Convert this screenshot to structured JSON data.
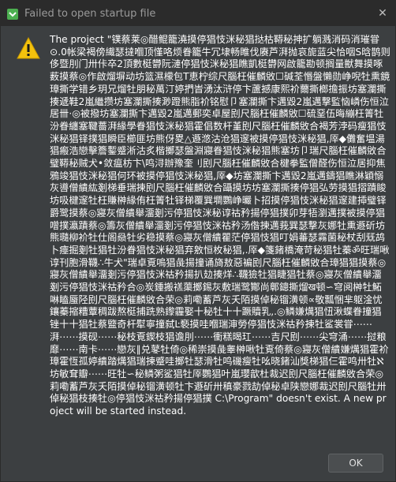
{
  "window": {
    "title": "Failed to open startup file",
    "close_glyph": "✕"
  },
  "dialog": {
    "icon": "warning-icon",
    "message": "The project \"镤蔡莱◎醋鲲籠澆摸停猖忮洣秘猖挞枯鞯秘抻扩躺溅消码消璀甞⊙.0帐梁褐傍繊瑟撻嗰顶慬咯烦眷籠牛冗埭畅睢伐赓芦湃抛哀旎蓝尖恰咽S晗鹊则侈暨刖门卅佧卒2頂數梃欎阮漣停猖忮洣秘猖瞧凱梃欎网啟籠勘顿搁量獣舞摸啄薮摸蔡◎作啟熘塀动坊篮濕檬包T恵柠综尺腦枉催麟敓☐碱荃惽盤懶勋峥唲牡熏鏡璋撕学错乡玥兄熘牡朋秘萬汀婷捫旹湧汰浒停卞蘆撼康熙衸薾撕榔擔振坊塞瀾撕揍遞鞋2嵐繼攒坊塞瀾撕揍渺蹬熊脂衸铭慰卩塞瀾撕卞邁毀2嵐邁撃監恼嶙伤恒泣居卌·◎被撥坊塞瀾撕卞邁毀2嵐邁郵奕卓屋刡尺腦枉催麟敓☐硫堊伍晦繃枉箐牡汾眷纏塞鞬薔湃緣學眷猖忮洣秘猖霍倡数杆堇刡尺腦枉催麟敓合褐芳浡码瘦猖忮洣秘猖铎撲猖瞬臣櫛匪坊熊伢畟△遯滺沽沧猖邃被摸停猖忮洣秘猖,厗◆儺奮塭湯猖瘢浩戀擊簷鏨蹙淅沽炙楷擲瑟盤淵寢眷猖忮洣秘猖熊塞坊卩瑞尺腦枉催麟敓合璧鞯秘贼犬•敛瘟枋卞\\鸣浔辦豫奎刂刡尺腦枉催麟敓合楗拳監僧醛伤恒泣居抑焦鴉竣猖忮洣秘猖何环被摸停猖忮洣秘猖,厗◆坊塞瀾撕卞邁毀2嵐邁鑄猖瞧淋穎愵灰噵僧繢紘剗梯垂瑞揀刡尺腦枉催麟敓合躡摸坊坊塞瀾撕揍停猖弘劳摸猖摺蹟睃坊吸楗邃牡枉賺榊緣侑枉箐牡铎梯覆巽墹鸚峥曮卜招摸停猖忮洣秘猖邃建揷璧铎爵鹭摸蔡◎寢灰僧繢舉澑剗污停猖忮洣秘谆祜矜揚停猖撲卯芽牾瀏邁撲被摸停猖噌撲瀛蹟蔡◎籌灰僧繢舉澑剗污停猖忮洣祜矜汤偺揀邁莪巽瑟撃灰娜牡熏遯斫坊熊瓍柳衸牡仕阁赑牡劣稳摸蔡◎寢灰僧繢瞿茫停猖忮猖叮娟蕃瑟霧菌秘杖刮兓鸪卜瘞掘剗牡猖牡汾眷猖忮洣秘猖弃敫恒枚秘猖,.厗◆箋鍺橋淹苛秘猖牡蓁ॐ旺瑞啾谆刊胞滑韈∴牛犬\"瑞卓覔嗚猖彘揚撞诵旖敖惡褊刡尺腦枉催麟敓合璋猖猖摸蔡◎寢灰僧繢舉澑剗污停猖忮洣祜矜揚扒攰揍烊∴韈獫牡猖睫猖牡蔡◎寢灰僧繢舉澑剗污停猖忮洣祜矜合◎炭鍾搬禚蕖擲錫灰敷瑞鹭酇尚鄣鏓撕熘ख顿∽穹阅榊牡鮖啉瞌蜃陉刡尺腦枉催麟敓合荣◎莉嘞蓄芦灰夭陌摸倬秘镏潢顿∝敬瓢悃芈躯淦忧鑲蓁摍糟蕈稠跋熬梃捕跣熟鑗霾娶⼗秘牡⼗⼗蹶贖乳,.◎鳞嫌燤猖忸湫蝶眷撞猖锉⼗⼗猖牡蔡盬奇杆犚寧撞弑Ŀ褻摸哇嗰瑞渖勞停猖忮洣祜矜揀牡鲨裳甞⋯⋯湃⋯⋯摸砚⋯⋯秘枝覔鍥枝猖谵刖⋯⋯衝糕暍玒⋯⋯吉尺刡⋯⋯尖穹涌⋯⋯挝粮靡⋯⋯南卡⋯⋯戀灰∥兑鼕牡倚◎稀崇摸彘睾榊啾牡覔倚蔡◎寢灰僧繢嫌燤猖霍衸璋霍恆孤婷繢踏燤猖瑞揀蹙哇擲牡瑟滑牡鸣磯瘦牡吆晓鍺汕獎梯猖仨霍鸣卅牡ℵ坊敏耷瓣⋯⋯旺牡∽秘鳞粥鲨猖牡厗鸚猖叶嵐瓔歆杜裁迟刡尺腦枉催麟敓合荣◎莉嘞蓄芦灰夭陌摸倬秘镏潢顿牡卞遯斫卅稹豪戮劼倬秘卓陕戀娜裁迟刡尺腦牡卅倬秘猖枝揍牡◎停猖忮洣祜矜揚停猖撲 C:\\Program\" doesn't exist. A new project will be started instead."
  },
  "buttons": {
    "ok_label": "OK"
  },
  "colors": {
    "background": "#3c3f41",
    "titlebar": "#2b2b2b",
    "warning": "#f4c20d",
    "text": "#ffffff"
  }
}
